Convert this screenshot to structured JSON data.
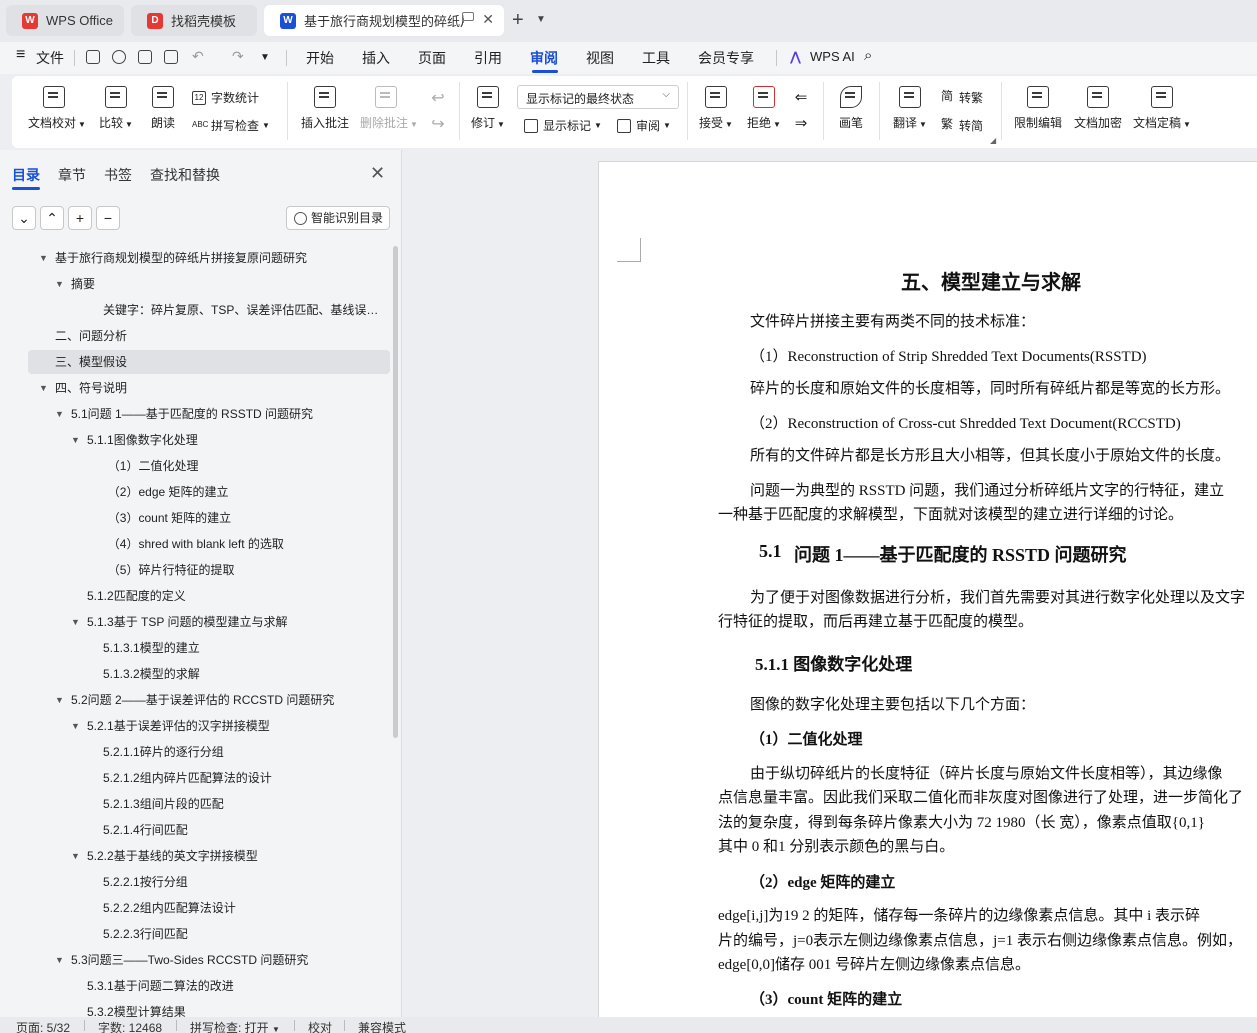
{
  "tabs": [
    {
      "label": "WPS Office",
      "icon": "wps-logo-icon",
      "color": "#e53935"
    },
    {
      "label": "找稻壳模板",
      "icon": "docer-icon",
      "color": "#e53935"
    },
    {
      "label": "基于旅行商规划模型的碎纸片拼",
      "icon": "writer-doc-icon",
      "color": "#1a4fd6"
    }
  ],
  "menu": {
    "file": "文件",
    "items": [
      "开始",
      "插入",
      "页面",
      "引用",
      "审阅",
      "视图",
      "工具",
      "会员专享"
    ],
    "active": "审阅",
    "wps_ai": "WPS AI"
  },
  "ribbon": {
    "doc_check": "文档校对",
    "compare": "比较",
    "read_aloud": "朗读",
    "word_count": "字数统计",
    "spell_check": "拼写检查",
    "insert_comment": "插入批注",
    "delete_comment": "删除批注",
    "track_changes": "修订",
    "markup_state": "显示标记的最终状态",
    "show_markup": "显示标记",
    "review_pane": "审阅",
    "accept": "接受",
    "reject": "拒绝",
    "draw": "画笔",
    "translate": "翻译",
    "to_traditional": "转繁",
    "to_simplified": "转简",
    "restrict_edit": "限制编辑",
    "encrypt": "文档加密",
    "finalize": "文档定稿"
  },
  "sidebar": {
    "tabs": [
      "目录",
      "章节",
      "书签",
      "查找和替换"
    ],
    "smart_toc": "智能识别目录",
    "toc": [
      {
        "text": "基于旅行商规划模型的碎纸片拼接复原问题研究",
        "level": 0,
        "arrow": true
      },
      {
        "text": "摘要",
        "level": 1,
        "arrow": true
      },
      {
        "text": "关键字：碎片复原、TSP、误差评估匹配、基线误差...",
        "level": 3,
        "arrow": false
      },
      {
        "text": "二、问题分析",
        "level": 0,
        "arrow": false
      },
      {
        "text": "三、模型假设",
        "level": 0,
        "arrow": false,
        "selected": true
      },
      {
        "text": "四、符号说明",
        "level": 0,
        "arrow": true
      },
      {
        "text": "5.1问题 1——基于匹配度的 RSSTD 问题研究",
        "level": 1,
        "arrow": true
      },
      {
        "text": "5.1.1图像数字化处理",
        "level": 2,
        "arrow": true
      },
      {
        "text": "（1）二值化处理",
        "level": 3.3,
        "arrow": false
      },
      {
        "text": "（2）edge 矩阵的建立",
        "level": 3.3,
        "arrow": false
      },
      {
        "text": "（3）count 矩阵的建立",
        "level": 3.3,
        "arrow": false
      },
      {
        "text": "（4）shred with blank left 的选取",
        "level": 3.3,
        "arrow": false
      },
      {
        "text": "（5）碎片行特征的提取",
        "level": 3.3,
        "arrow": false
      },
      {
        "text": "5.1.2匹配度的定义",
        "level": 2,
        "arrow": false
      },
      {
        "text": "5.1.3基于 TSP 问题的模型建立与求解",
        "level": 2,
        "arrow": true
      },
      {
        "text": "5.1.3.1模型的建立",
        "level": 3,
        "arrow": false
      },
      {
        "text": "5.1.3.2模型的求解",
        "level": 3,
        "arrow": false
      },
      {
        "text": "5.2问题 2——基于误差评估的 RCCSTD 问题研究",
        "level": 1,
        "arrow": true
      },
      {
        "text": "5.2.1基于误差评估的汉字拼接模型",
        "level": 2,
        "arrow": true
      },
      {
        "text": "5.2.1.1碎片的逐行分组",
        "level": 3,
        "arrow": false
      },
      {
        "text": "5.2.1.2组内碎片匹配算法的设计",
        "level": 3,
        "arrow": false
      },
      {
        "text": "5.2.1.3组间片段的匹配",
        "level": 3,
        "arrow": false
      },
      {
        "text": "5.2.1.4行间匹配",
        "level": 3,
        "arrow": false
      },
      {
        "text": "5.2.2基于基线的英文字拼接模型",
        "level": 2,
        "arrow": true
      },
      {
        "text": "5.2.2.1按行分组",
        "level": 3,
        "arrow": false
      },
      {
        "text": "5.2.2.2组内匹配算法设计",
        "level": 3,
        "arrow": false
      },
      {
        "text": "5.2.2.3行间匹配",
        "level": 3,
        "arrow": false
      },
      {
        "text": "5.3问题三——Two-Sides RCCSTD 问题研究",
        "level": 1,
        "arrow": true
      },
      {
        "text": "5.3.1基于问题二算法的改进",
        "level": 2,
        "arrow": false
      },
      {
        "text": "5.3.2模型计算结果",
        "level": 2,
        "arrow": false
      }
    ]
  },
  "document": {
    "h_section": "五、模型建立与求解",
    "p1": "文件碎片拼接主要有两类不同的技术标准：",
    "p2": "（1）Reconstruction of Strip Shredded Text Documents(RSSTD)",
    "p3": "碎片的长度和原始文件的长度相等，同时所有碎纸片都是等宽的长方形。",
    "p4": "（2）Reconstruction of Cross-cut  Shredded Text Document(RCCSTD)",
    "p5": "所有的文件碎片都是长方形且大小相等，但其长度小于原始文件的长度。",
    "p6a": "问题一为典型的 RSSTD 问题，我们通过分析碎纸片文字的行特征，建立",
    "p6b": "一种基于匹配度的求解模型，下面就对该模型的建立进行详细的讨论。",
    "h51_num": "5.1",
    "h51": "问题 1——基于匹配度的 RSSTD 问题研究",
    "p7a": "为了便于对图像数据进行分析，我们首先需要对其进行数字化处理以及文字",
    "p7b": "行特征的提取，而后再建立基于匹配度的模型。",
    "h511": "5.1.1 图像数字化处理",
    "p8": "图像的数字化处理主要包括以下几个方面：",
    "h_binary": "（1）二值化处理",
    "p9a": "由于纵切碎纸片的长度特征（碎片长度与原始文件长度相等），其边缘像",
    "p9b": "点信息量丰富。因此我们采取二值化而非灰度对图像进行了处理，进一步简化了",
    "p9c": "法的复杂度，得到每条碎片像素大小为 72    1980（长    宽），像素点值取{0,1}",
    "p9d": "其中 0 和1 分别表示颜色的黑与白。",
    "h_edge": "（2）edge 矩阵的建立",
    "p10a": "edge[i,j]为19     2 的矩阵，储存每一条碎片的边缘像素点信息。其中 i 表示碎",
    "p10b": "片的编号，j=0表示左侧边缘像素点信息，j=1 表示右侧边缘像素点信息。例如，",
    "p10c": "edge[0,0]储存 001 号碎片左侧边缘像素点信息。",
    "h_count": "（3）count 矩阵的建立"
  },
  "status": {
    "page": "页面: 5/32",
    "words": "字数: 12468",
    "spell": "拼写检查: 打开",
    "proof": "校对",
    "compat": "兼容模式"
  }
}
